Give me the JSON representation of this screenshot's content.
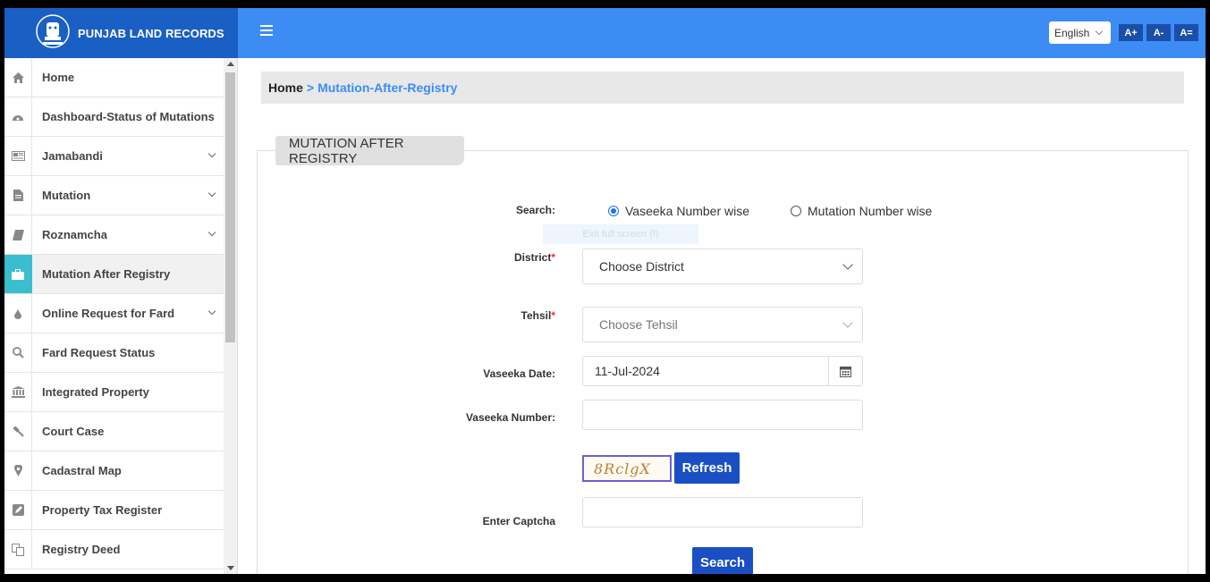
{
  "header": {
    "brand_title": "PUNJAB LAND RECORDS",
    "language": "English",
    "font_buttons": [
      "A+",
      "A-",
      "A="
    ]
  },
  "sidebar": {
    "items": [
      {
        "label": "Home",
        "icon": "home-icon",
        "dropdown": false,
        "active": false
      },
      {
        "label": "Dashboard-Status of Mutations",
        "icon": "dashboard-icon",
        "dropdown": false,
        "active": false
      },
      {
        "label": "Jamabandi",
        "icon": "newspaper-icon",
        "dropdown": true,
        "active": false
      },
      {
        "label": "Mutation",
        "icon": "file-icon",
        "dropdown": true,
        "active": false
      },
      {
        "label": "Roznamcha",
        "icon": "book-icon",
        "dropdown": true,
        "active": false
      },
      {
        "label": "Mutation After Registry",
        "icon": "briefcase-icon",
        "dropdown": false,
        "active": true
      },
      {
        "label": "Online Request for Fard",
        "icon": "drop-icon",
        "dropdown": true,
        "active": false
      },
      {
        "label": "Fard Request Status",
        "icon": "search-icon",
        "dropdown": false,
        "active": false
      },
      {
        "label": "Integrated Property",
        "icon": "bank-icon",
        "dropdown": false,
        "active": false
      },
      {
        "label": "Court Case",
        "icon": "gavel-icon",
        "dropdown": false,
        "active": false
      },
      {
        "label": "Cadastral Map",
        "icon": "map-pin-icon",
        "dropdown": false,
        "active": false
      },
      {
        "label": "Property Tax Register",
        "icon": "edit-icon",
        "dropdown": false,
        "active": false
      },
      {
        "label": "Registry Deed",
        "icon": "copy-icon",
        "dropdown": false,
        "active": false
      }
    ]
  },
  "breadcrumb": {
    "home": "Home",
    "separator": ">",
    "current": "Mutation-After-Registry"
  },
  "form": {
    "panel_title": "MUTATION AFTER REGISTRY",
    "search_label": "Search:",
    "search_options": [
      {
        "label": "Vaseeka Number wise",
        "selected": true
      },
      {
        "label": "Mutation Number wise",
        "selected": false
      }
    ],
    "district_label": "District",
    "district_value": "Choose District",
    "tehsil_label": "Tehsil",
    "tehsil_value": "Choose Tehsil",
    "vaseeka_date_label": "Vaseeka Date:",
    "vaseeka_date_value": "11-Jul-2024",
    "vaseeka_number_label": "Vaseeka Number:",
    "vaseeka_number_value": "",
    "captcha_text": "8RclgX",
    "refresh_label": "Refresh",
    "captcha_label": "Enter Captcha",
    "captcha_value": "",
    "search_button": "Search",
    "required_mark": "*",
    "ghost_tooltip": "Exit full screen (f)"
  },
  "colors": {
    "brand": "#1a5fc4",
    "topbar": "#3c8cf4",
    "active_icon": "#3bbdd0",
    "button": "#1a4fc4"
  }
}
